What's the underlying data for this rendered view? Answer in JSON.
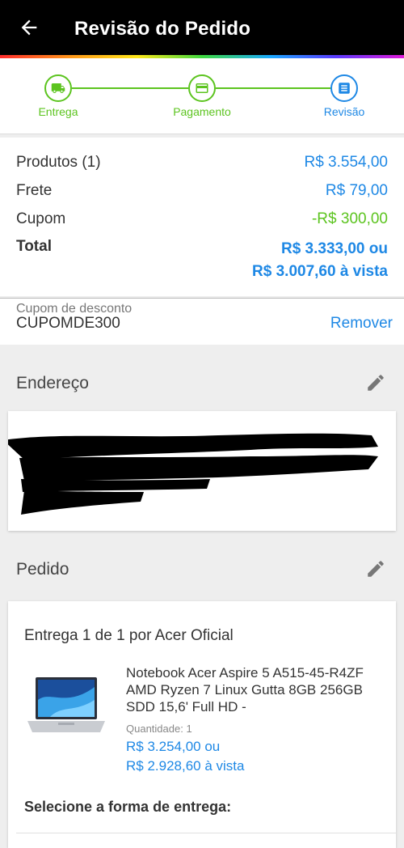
{
  "header": {
    "title": "Revisão do Pedido"
  },
  "steps": [
    {
      "label": "Entrega"
    },
    {
      "label": "Pagamento"
    },
    {
      "label": "Revisão"
    }
  ],
  "summary": {
    "products_label": "Produtos (1)",
    "products_value": "R$ 3.554,00",
    "freight_label": "Frete",
    "freight_value": "R$ 79,00",
    "coupon_label": "Cupom",
    "coupon_value": "-R$ 300,00",
    "total_label": "Total",
    "total_value_1": "R$ 3.333,00 ou",
    "total_value_2": "R$ 3.007,60 à vista"
  },
  "coupon": {
    "label": "Cupom de desconto",
    "code": "CUPOMDE300",
    "remove_label": "Remover"
  },
  "address": {
    "title": "Endereço"
  },
  "order": {
    "title": "Pedido",
    "delivery_heading": "Entrega 1 de 1 por Acer Oficial",
    "product_name": "Notebook Acer Aspire 5 A515-45-R4ZF AMD Ryzen 7 Linux Gutta 8GB 256GB SDD 15,6' Full HD -",
    "quantity": "Quantidade:  1",
    "price_installment": "R$ 3.254,00 ou",
    "price_cash": "R$ 2.928,60 à vista",
    "select_delivery": "Selecione a forma de entrega:"
  },
  "colors": {
    "accent_blue": "#1e88e5",
    "accent_green": "#5cc41f",
    "appbar": "#000000"
  }
}
